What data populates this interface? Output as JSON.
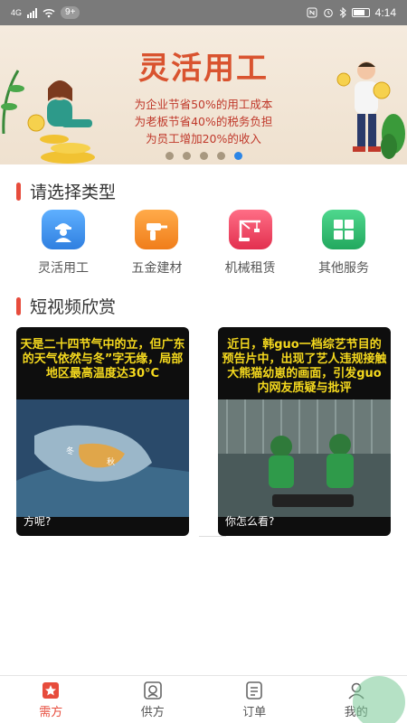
{
  "status_bar": {
    "network": "4G",
    "notif_badge": "9+",
    "time": "4:14"
  },
  "banner": {
    "title": "灵活用工",
    "lines": [
      "为企业节省50%的用工成本",
      "为老板节省40%的税务负担",
      "为员工增加20%的收入"
    ],
    "dot_count": 5,
    "active_dot": 4
  },
  "categories_section": {
    "title": "请选择类型",
    "items": [
      {
        "label": "灵活用工",
        "icon": "worker-icon",
        "color": "#3d8ee8"
      },
      {
        "label": "五金建材",
        "icon": "drill-icon",
        "color": "#f08a24"
      },
      {
        "label": "机械租赁",
        "icon": "crane-icon",
        "color": "#ec3d5a"
      },
      {
        "label": "其他服务",
        "icon": "boxes-icon",
        "color": "#2fbf71"
      }
    ]
  },
  "video_section": {
    "title": "短视频欣赏",
    "videos": [
      {
        "caption": "天是二十四节气中的立，但广东的天气依然与冬”字无缘，局部地区最高温度达30°C",
        "footer": "方呢?"
      },
      {
        "caption": "近日，韩guo一档综艺节目的预告片中，出现了艺人违规接触大熊猫幼崽的画面，引发guo内网友质疑与批评",
        "footer": "你怎么看?"
      }
    ]
  },
  "tabbar": {
    "tabs": [
      {
        "label": "需方",
        "icon": "star-bookmark-icon",
        "active": true
      },
      {
        "label": "供方",
        "icon": "supplier-icon",
        "active": false
      },
      {
        "label": "订单",
        "icon": "order-list-icon",
        "active": false
      },
      {
        "label": "我的",
        "icon": "profile-icon",
        "active": false
      }
    ]
  },
  "colors": {
    "accent": "#e74c3c",
    "banner_title": "#d9532f"
  }
}
